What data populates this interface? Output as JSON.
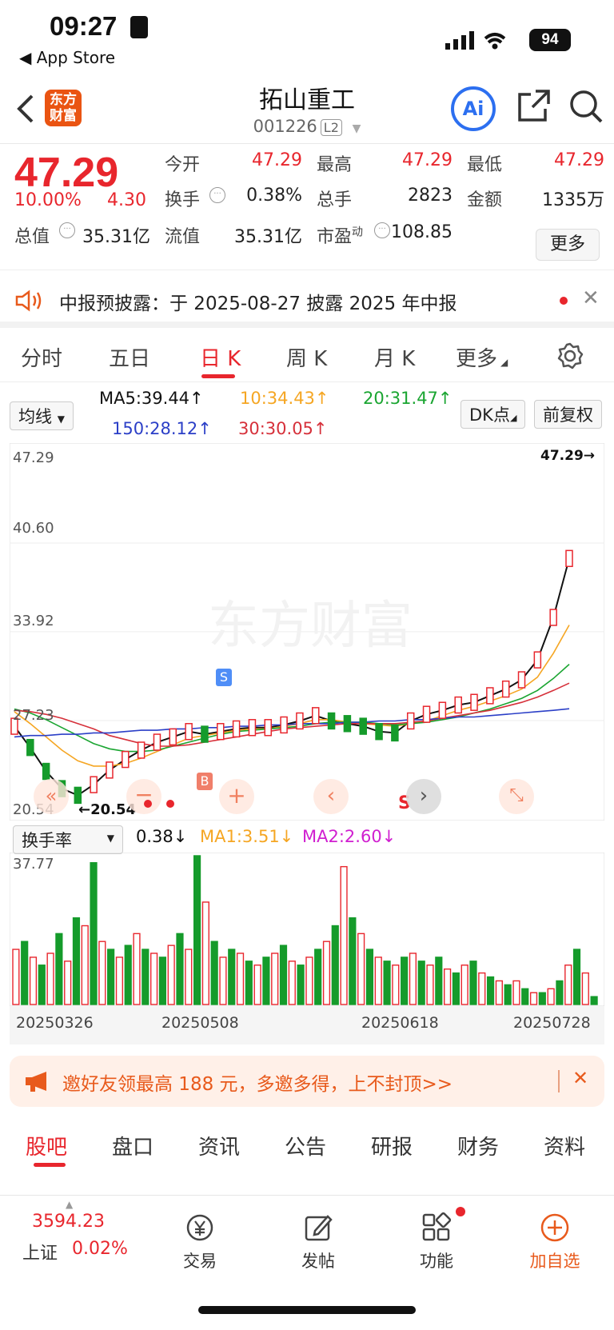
{
  "status_bar": {
    "time": "09:27",
    "back_app": "◀ App Store",
    "battery": "94"
  },
  "nav": {
    "title": "拓山重工",
    "code": "001226",
    "level": "L2",
    "ai": "Ai"
  },
  "quote": {
    "price": "47.29",
    "change_pct": "10.00%",
    "change": "4.30",
    "open_label": "今开",
    "open": "47.29",
    "high_label": "最高",
    "high": "47.29",
    "low_label": "最低",
    "low": "47.29",
    "turnover_label": "换手",
    "turnover": "0.38%",
    "volume_label": "总手",
    "volume": "2823",
    "amount_label": "金额",
    "amount": "1335万",
    "mktcap_label": "总值",
    "mktcap": "35.31亿",
    "float_label": "流值",
    "float": "35.31亿",
    "pe_label": "市盈",
    "pe_sup": "动",
    "pe": "108.85",
    "more": "更多"
  },
  "notice": {
    "text": "中报预披露：于 2025-08-27 披露 2025 年中报"
  },
  "chart_tabs": [
    "分时",
    "五日",
    "日 K",
    "周 K",
    "月 K",
    "更多"
  ],
  "ma_row": {
    "selector": "均线",
    "ma5": "MA5:39.44↑",
    "ma10": "10:34.43↑",
    "ma20": "20:31.47↑",
    "ma150": "150:28.12↑",
    "ma30": "30:30.05↑",
    "dk": "DK点",
    "adjust": "前复权"
  },
  "colors": {
    "up": "#e8262d",
    "down": "#159b2b",
    "ma5": "#111111",
    "ma10": "#f5a623",
    "ma20": "#1aa531",
    "ma30": "#d6303a",
    "ma150": "#2b3fc7",
    "accent": "#ea5412"
  },
  "chart_data": {
    "type": "line",
    "y_ticks": [
      "47.29",
      "40.60",
      "33.92",
      "27.23",
      "20.54"
    ],
    "ylim": [
      20.54,
      47.29
    ],
    "last_price_label": "47.29→",
    "low_marker": "←20.54",
    "x_ticks": [
      "20250326",
      "20250508",
      "20250618",
      "20250728"
    ],
    "signals": {
      "buy": "B",
      "sell": "S",
      "sell2": "S"
    },
    "series": [
      {
        "name": "MA5",
        "values": [
          26.8,
          25.2,
          23.4,
          22.1,
          21.6,
          22.4,
          23.5,
          24.3,
          25.0,
          25.6,
          26.0,
          26.4,
          26.2,
          26.4,
          26.6,
          26.7,
          26.7,
          26.9,
          27.2,
          27.6,
          27.2,
          27.0,
          26.8,
          26.4,
          26.3,
          27.2,
          27.7,
          28.0,
          28.4,
          28.6,
          29.1,
          29.6,
          30.3,
          31.8,
          35.0,
          39.44
        ]
      },
      {
        "name": "MA10",
        "values": [
          27.9,
          27.0,
          26.0,
          25.0,
          24.2,
          23.8,
          23.8,
          24.0,
          24.4,
          24.9,
          25.4,
          25.9,
          26.1,
          26.3,
          26.5,
          26.6,
          26.6,
          26.8,
          27.0,
          27.3,
          27.3,
          27.1,
          27.0,
          26.9,
          26.8,
          27.0,
          27.2,
          27.6,
          28.0,
          28.3,
          28.7,
          29.1,
          29.6,
          30.5,
          32.3,
          34.43
        ]
      },
      {
        "name": "MA20",
        "values": [
          28.1,
          27.8,
          27.3,
          26.7,
          26.1,
          25.5,
          25.1,
          24.9,
          24.9,
          25.0,
          25.3,
          25.6,
          25.9,
          26.2,
          26.4,
          26.5,
          26.6,
          26.7,
          26.8,
          27.0,
          27.1,
          27.1,
          27.1,
          27.0,
          26.9,
          27.0,
          27.1,
          27.3,
          27.5,
          27.8,
          28.1,
          28.5,
          28.9,
          29.5,
          30.4,
          31.47
        ]
      },
      {
        "name": "MA30",
        "values": [
          28.0,
          27.9,
          27.7,
          27.4,
          27.0,
          26.6,
          26.1,
          25.8,
          25.5,
          25.3,
          25.3,
          25.4,
          25.6,
          25.8,
          26.0,
          26.2,
          26.4,
          26.6,
          26.7,
          26.8,
          26.9,
          27.0,
          27.0,
          27.0,
          27.0,
          27.1,
          27.2,
          27.4,
          27.6,
          27.8,
          28.0,
          28.3,
          28.6,
          29.0,
          29.5,
          30.05
        ]
      },
      {
        "name": "MA150",
        "values": [
          26.0,
          26.1,
          26.1,
          26.2,
          26.2,
          26.3,
          26.3,
          26.4,
          26.5,
          26.5,
          26.6,
          26.6,
          26.7,
          26.7,
          26.8,
          26.8,
          26.9,
          26.9,
          27.0,
          27.0,
          27.0,
          27.1,
          27.1,
          27.2,
          27.2,
          27.3,
          27.3,
          27.4,
          27.5,
          27.5,
          27.6,
          27.7,
          27.8,
          27.9,
          28.0,
          28.12
        ]
      }
    ]
  },
  "volume": {
    "selector": "换手率",
    "value": "0.38↓",
    "ma1": "MA1:3.51↓",
    "ma2": "MA2:2.60↓",
    "y_max_label": "37.77",
    "bars": [
      14,
      16,
      12,
      10,
      13,
      18,
      11,
      22,
      20,
      36,
      16,
      14,
      12,
      15,
      18,
      14,
      13,
      12,
      15,
      18,
      14,
      37.77,
      26,
      16,
      12,
      14,
      13,
      11,
      10,
      12,
      13,
      15,
      11,
      10,
      12,
      14,
      16,
      20,
      35,
      22,
      18,
      14,
      12,
      11,
      10,
      12,
      13,
      11,
      10,
      12,
      9,
      8,
      10,
      11,
      8,
      7,
      6,
      5,
      6,
      4,
      3,
      3,
      4,
      6,
      10,
      14,
      8,
      2
    ]
  },
  "promo": {
    "text": "邀好友领最高 188 元，多邀多得，上不封顶>>"
  },
  "sub_tabs": [
    "股吧",
    "盘口",
    "资讯",
    "公告",
    "研报",
    "财务",
    "资料"
  ],
  "bottom_bar": {
    "index_value": "3594.23",
    "index_name": "上证",
    "index_change": "0.02%",
    "trade": "交易",
    "post": "发帖",
    "func": "功能",
    "add": "加自选"
  }
}
